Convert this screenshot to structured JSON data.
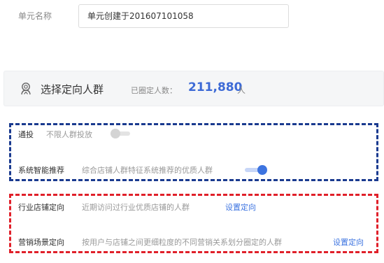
{
  "unit": {
    "label": "单元名称",
    "value": "单元创建于201607101058"
  },
  "header": {
    "icon": "crowd-target-icon",
    "title": "选择定向人群",
    "count_label": "已圈定人数：",
    "count_value": "211,880",
    "count_unit": "人"
  },
  "rows": [
    {
      "title": "通投",
      "desc": "不限人群投放",
      "toggle_on": false
    },
    {
      "title": "系统智能推荐",
      "desc": "综合店铺人群特征系统推荐的优质人群",
      "toggle_on": true
    },
    {
      "title": "行业店铺定向",
      "desc": "近期访问过行业优质店铺的人群",
      "link": "设置定向"
    },
    {
      "title": "营销场景定向",
      "desc": "按用户与店铺之间更细粒度的不同营销关系划分圈定的人群",
      "link": "设置定向"
    }
  ],
  "colors": {
    "accent": "#3d74e0",
    "count": "#3d6ad6",
    "box_blue": "#1a3a8f",
    "box_red": "#e0202a"
  }
}
